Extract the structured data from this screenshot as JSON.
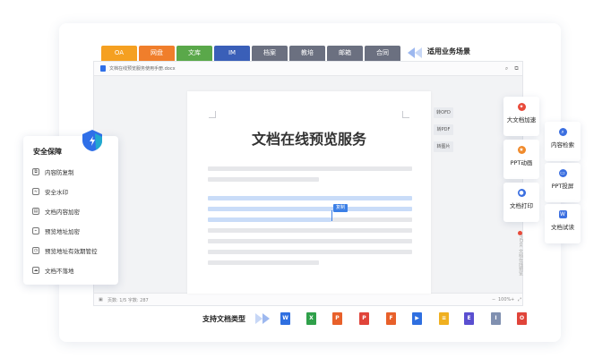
{
  "scenario": {
    "tabs": [
      {
        "label": "OA",
        "color": "#f5a021"
      },
      {
        "label": "网盘",
        "color": "#f07e2b"
      },
      {
        "label": "文库",
        "color": "#5aa84a"
      },
      {
        "label": "IM",
        "color": "#3a5fb8"
      },
      {
        "label": "档案",
        "color": "#6b7080"
      },
      {
        "label": "教培",
        "color": "#6b7080"
      },
      {
        "label": "邮箱",
        "color": "#6b7080"
      },
      {
        "label": "合同",
        "color": "#6b7080"
      }
    ],
    "label": "适用业务场景"
  },
  "viewer": {
    "title": "文档在线预览服务使用手册.docx",
    "footer_left": "页数: 1/5    字数: 287",
    "zoom": "100%",
    "doc_title": "文档在线预览服务",
    "copy_tag": "复制",
    "side_buttons": [
      "转OFD",
      "转PDF",
      "转图片"
    ],
    "brand": "mDoc 文档在线预览"
  },
  "security": {
    "title": "安全保障",
    "items": [
      {
        "icon": "copy-protect-icon",
        "label": "内容防复制"
      },
      {
        "icon": "watermark-icon",
        "label": "安全水印"
      },
      {
        "icon": "encrypt-icon",
        "label": "文档内容加密"
      },
      {
        "icon": "link-encrypt-icon",
        "label": "预览地址加密"
      },
      {
        "icon": "expiry-icon",
        "label": "预览地址有效期管控"
      },
      {
        "icon": "cloud-icon",
        "label": "文档不落地"
      }
    ]
  },
  "features": [
    {
      "label": "大文档加速",
      "icon": "speed-icon",
      "color": "#e84a3a"
    },
    {
      "label": "PPT动画",
      "icon": "star-icon",
      "color": "#f08a2b"
    },
    {
      "label": "文档打印",
      "icon": "print-icon",
      "color": "#3b6fe0"
    },
    {
      "label": "内容检索",
      "icon": "search-icon",
      "color": "#3b6fe0"
    },
    {
      "label": "PPT投屏",
      "icon": "cast-icon",
      "color": "#3b6fe0"
    },
    {
      "label": "文档试读",
      "icon": "read-icon",
      "color": "#3b6fe0"
    }
  ],
  "file_types": {
    "label": "支持文档类型",
    "items": [
      {
        "glyph": "W",
        "color": "#2f6fe0"
      },
      {
        "glyph": "X",
        "color": "#2fa04a"
      },
      {
        "glyph": "P",
        "color": "#e8602a"
      },
      {
        "glyph": "P",
        "color": "#e0443a"
      },
      {
        "glyph": "F",
        "color": "#e8602a"
      },
      {
        "glyph": "▶",
        "color": "#2f6fe0"
      },
      {
        "glyph": "≡",
        "color": "#f0b020"
      },
      {
        "glyph": "E",
        "color": "#5a4fd0"
      },
      {
        "glyph": "I",
        "color": "#8090b0"
      },
      {
        "glyph": "O",
        "color": "#e0443a"
      }
    ]
  }
}
